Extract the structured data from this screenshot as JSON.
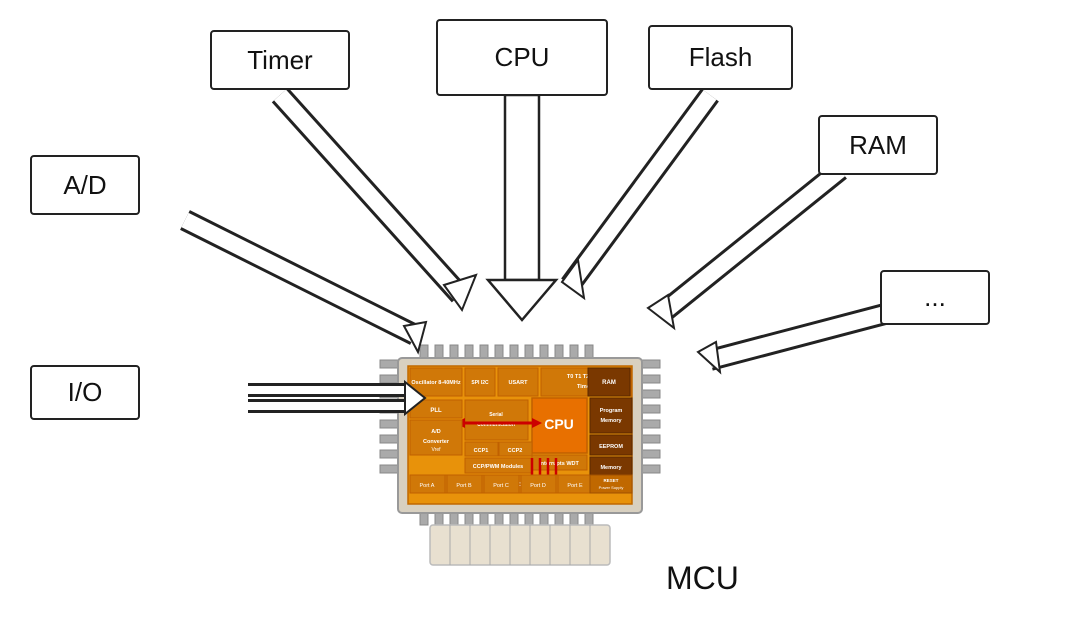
{
  "labels": {
    "cpu": "CPU",
    "timer": "Timer",
    "flash": "Flash",
    "ram": "RAM",
    "ad": "A/D",
    "io": "I/O",
    "dots": "...",
    "mcu": "MCU"
  },
  "colors": {
    "arrow_fill": "#ffffff",
    "arrow_stroke": "#222222",
    "box_border": "#222222",
    "chip_orange": "#e8920a",
    "chip_dark": "#7a3800"
  }
}
